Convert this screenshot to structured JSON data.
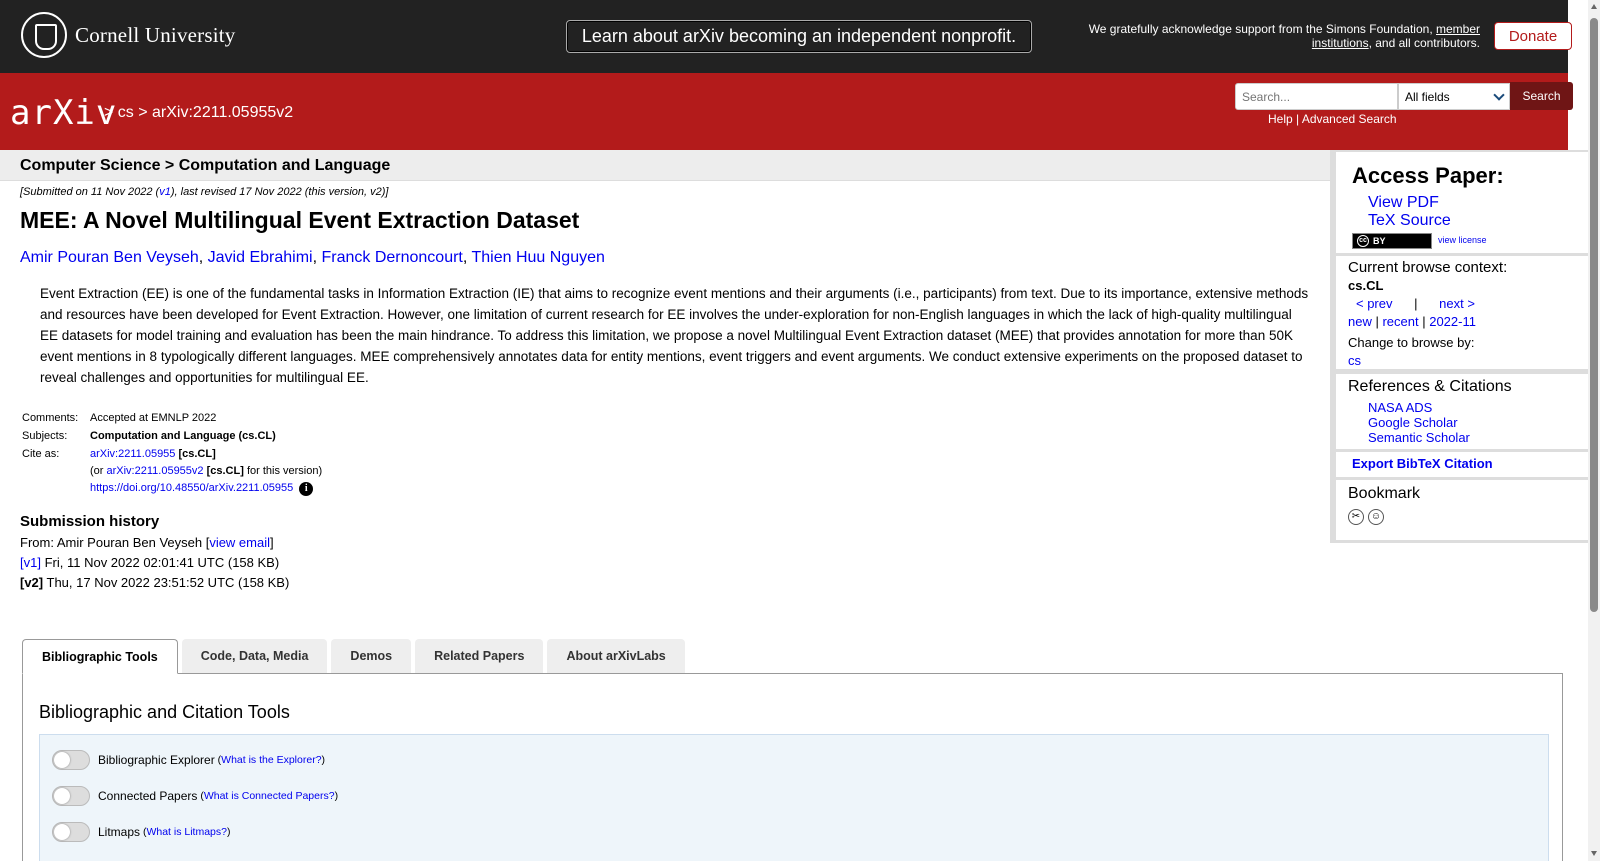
{
  "topbar": {
    "institution": "Cornell University",
    "nonprofit_banner": "Learn about arXiv becoming an independent nonprofit.",
    "support_prefix": "We gratefully acknowledge support from the Simons Foundation, ",
    "support_link": "member institutions",
    "support_suffix": ", and all contributors.",
    "donate_label": "Donate"
  },
  "header": {
    "logo_text": "arXiv",
    "crumb_sep1": " > ",
    "crumb_cs": "cs",
    "crumb_sep2": " > ",
    "crumb_paper": "arXiv:2211.05955v2",
    "search_placeholder": "Search...",
    "field_select_value": "All fields",
    "search_button": "Search",
    "help_link": "Help",
    "help_sep": " | ",
    "advanced_link": "Advanced Search"
  },
  "subject_bar": {
    "text": "Computer Science > Computation and Language"
  },
  "paper": {
    "dateline_prefix": "[Submitted on 11 Nov 2022 (",
    "dateline_v1": "v1",
    "dateline_suffix": "), last revised 17 Nov 2022 (this version, v2)]",
    "title": "MEE: A Novel Multilingual Event Extraction Dataset",
    "authors": [
      "Amir Pouran Ben Veyseh",
      "Javid Ebrahimi",
      "Franck Dernoncourt",
      "Thien Huu Nguyen"
    ],
    "author_sep": ", ",
    "abstract": "Event Extraction (EE) is one of the fundamental tasks in Information Extraction (IE) that aims to recognize event mentions and their arguments (i.e., participants) from text. Due to its importance, extensive methods and resources have been developed for Event Extraction. However, one limitation of current research for EE involves the under-exploration for non-English languages in which the lack of high-quality multilingual EE datasets for model training and evaluation has been the main hindrance. To address this limitation, we propose a novel Multilingual Event Extraction dataset (MEE) that provides annotation for more than 50K event mentions in 8 typologically different languages. MEE comprehensively annotates data for entity mentions, event triggers and event arguments. We conduct extensive experiments on the proposed dataset to reveal challenges and opportunities for multilingual EE.",
    "comments_label": "Comments:",
    "comments_value": "Accepted at EMNLP 2022",
    "subjects_label": "Subjects:",
    "subjects_value": "Computation and Language (cs.CL)",
    "cite_label": "Cite as:",
    "cite_id": "arXiv:2211.05955",
    "cite_cat": " [cs.CL]",
    "cite_or": "(or ",
    "cite_version": "arXiv:2211.05955v2",
    "cite_version_cat": " [cs.CL]",
    "cite_version_suffix": " for this version)",
    "doi": "https://doi.org/10.48550/arXiv.2211.05955",
    "info_icon": "i"
  },
  "submission_history": {
    "heading": "Submission history",
    "from_prefix": "From: Amir Pouran Ben Veyseh [",
    "view_email": "view email",
    "from_suffix": "]",
    "v1_label": "[v1]",
    "v1_text": " Fri, 11 Nov 2022 02:01:41 UTC (158 KB)",
    "v2_label": "[v2]",
    "v2_text": " Thu, 17 Nov 2022 23:51:52 UTC (158 KB)"
  },
  "sidebar": {
    "access_heading": "Access Paper:",
    "view_pdf": "View PDF",
    "tex_source": "TeX Source",
    "cc_badge": "BY",
    "cc_symbol": "cc",
    "view_license": "view license",
    "browse_heading": "Current browse context:",
    "browse_context": "cs.CL",
    "prev": "< prev",
    "nav_sep": "|",
    "next": "next >",
    "new": "new",
    "recent": "recent",
    "month": "2022-11",
    "pipe": " | ",
    "change_browse": "Change to browse by:",
    "browse_cs": "cs",
    "refs_heading": "References & Citations",
    "refs": [
      "NASA ADS",
      "Google Scholar",
      "Semantic Scholar"
    ],
    "export_bibtex": "Export BibTeX Citation",
    "bookmark_heading": "Bookmark",
    "bookmark_icons": [
      "bibsonomy-icon",
      "reddit-icon"
    ]
  },
  "tabs": {
    "items": [
      "Bibliographic Tools",
      "Code, Data, Media",
      "Demos",
      "Related Papers",
      "About arXivLabs"
    ],
    "active": "Bibliographic Tools",
    "panel_heading": "Bibliographic and Citation Tools",
    "tools": [
      {
        "label": "Bibliographic Explorer",
        "what": "What is the Explorer?"
      },
      {
        "label": "Connected Papers",
        "what": "What is Connected Papers?"
      },
      {
        "label": "Litmaps",
        "what": "What is Litmaps?"
      }
    ]
  },
  "colors": {
    "arxiv_red": "#b31b1b",
    "topbar_bg": "#222222",
    "link_blue": "#0000ee"
  }
}
